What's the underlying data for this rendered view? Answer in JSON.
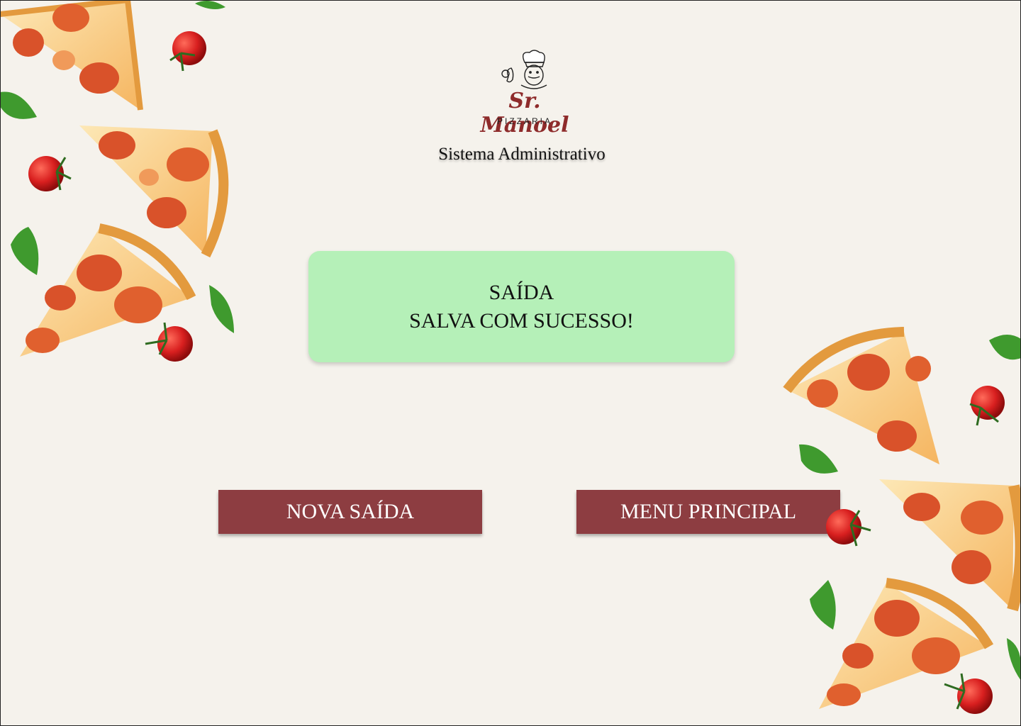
{
  "brand": {
    "name": "Sr. Manoel",
    "sub": "PIZZARIA",
    "subtitle": "Sistema Administrativo"
  },
  "message": {
    "line1": "SAÍDA",
    "line2": "SALVA COM SUCESSO!"
  },
  "actions": {
    "new_exit_label": "NOVA SAÍDA",
    "main_menu_label": "MENU PRINCIPAL"
  },
  "colors": {
    "background": "#f5f2ec",
    "success": "#b5f0b8",
    "button": "#8d3d41",
    "brand": "#8e2b2b"
  }
}
